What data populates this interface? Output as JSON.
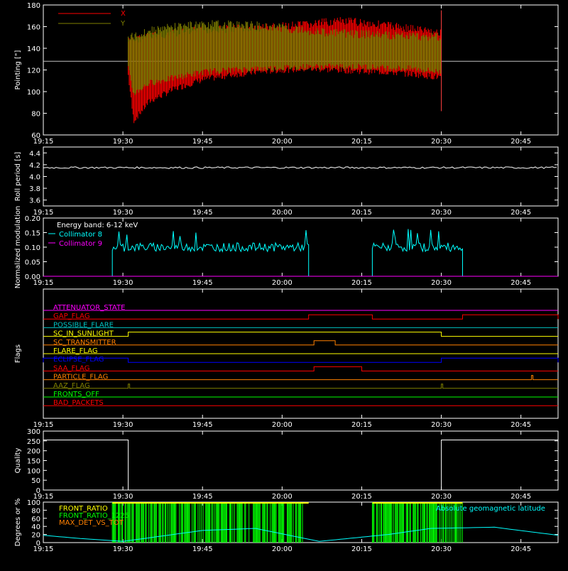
{
  "time_ticks": [
    "19:15",
    "19:30",
    "19:45",
    "20:00",
    "20:15",
    "20:30",
    "20:45"
  ],
  "chart_data": [
    {
      "type": "line",
      "title": "",
      "xlabel": "",
      "ylabel": "Pointing [\"]",
      "xlim": [
        "19:15",
        "20:52"
      ],
      "ylim": [
        60,
        180
      ],
      "yticks": [
        "60",
        "80",
        "100",
        "120",
        "140",
        "160",
        "180"
      ],
      "grid": false,
      "legend": "top-left",
      "reference_line": 128,
      "series": [
        {
          "name": "X",
          "color": "#ff0000",
          "x": [
            "19:31",
            "19:32",
            "19:35",
            "19:40",
            "19:45",
            "19:50",
            "19:55",
            "20:00",
            "20:05",
            "20:10",
            "20:15",
            "20:20",
            "20:25",
            "20:30"
          ],
          "upper": [
            150,
            152,
            155,
            158,
            161,
            162,
            163,
            164,
            166,
            169,
            168,
            165,
            162,
            158
          ],
          "lower": [
            112,
            70,
            88,
            100,
            108,
            112,
            115,
            117,
            118,
            117,
            116,
            115,
            113,
            110
          ]
        },
        {
          "name": "Y",
          "color": "#808000",
          "x": [
            "19:31",
            "19:32",
            "19:35",
            "19:40",
            "19:45",
            "19:50",
            "19:55",
            "20:00",
            "20:05",
            "20:10",
            "20:15",
            "20:20",
            "20:25",
            "20:30"
          ],
          "upper": [
            153,
            155,
            160,
            164,
            166,
            166,
            165,
            163,
            160,
            158,
            157,
            156,
            155,
            155
          ],
          "lower": [
            118,
            95,
            105,
            110,
            115,
            117,
            118,
            119,
            120,
            120,
            120,
            119,
            118,
            115
          ]
        }
      ]
    },
    {
      "type": "line",
      "title": "",
      "ylabel": "Roll period [s]",
      "xlim": [
        "19:15",
        "20:52"
      ],
      "ylim": [
        3.5,
        4.5
      ],
      "yticks": [
        "3.6",
        "3.8",
        "4.0",
        "4.2",
        "4.4"
      ],
      "series": [
        {
          "name": "",
          "color": "#ffffff",
          "value": 4.15
        }
      ]
    },
    {
      "type": "line",
      "title": "",
      "ylabel": "Normalized modulation",
      "xlim": [
        "19:15",
        "20:52"
      ],
      "ylim": [
        0,
        0.2
      ],
      "yticks": [
        "0.00",
        "0.05",
        "0.10",
        "0.15",
        "0.20"
      ],
      "legend": "top-left",
      "legend_header": "Energy band: 6-12 keV",
      "series": [
        {
          "name": "Collimator 8",
          "color": "#00ffff",
          "active_intervals": [
            [
              "19:28",
              "20:05"
            ],
            [
              "20:17",
              "20:34"
            ]
          ],
          "level": 0.1
        },
        {
          "name": "Collimator 9",
          "color": "#ff00ff",
          "value": 0.0
        }
      ]
    },
    {
      "type": "line",
      "title": "",
      "ylabel": "Flags",
      "xlim": [
        "19:15",
        "20:52"
      ],
      "series": [
        {
          "name": "ATTENUATOR_STATE",
          "color": "#ff00ff",
          "on": []
        },
        {
          "name": "GAP_FLAG",
          "color": "#ff0000",
          "on": [
            [
              "20:05",
              "20:17"
            ],
            [
              "20:34",
              "20:52"
            ]
          ]
        },
        {
          "name": "POSSIBLE_FLARE",
          "color": "#00c0c0",
          "on": []
        },
        {
          "name": "SC_IN_SUNLIGHT",
          "color": "#ffff00",
          "on": [
            [
              "19:31",
              "20:30"
            ]
          ]
        },
        {
          "name": "SC_TRANSMITTER",
          "color": "#ff8000",
          "on": [
            [
              "20:06",
              "20:10"
            ]
          ]
        },
        {
          "name": "FLARE_FLAG",
          "color": "#ffff00",
          "on": []
        },
        {
          "name": "ECLIPSE_FLAG",
          "color": "#0000ff",
          "on": [
            [
              "19:15",
              "19:31"
            ],
            [
              "20:30",
              "20:52"
            ]
          ]
        },
        {
          "name": "SAA_FLAG",
          "color": "#ff0000",
          "on": [
            [
              "20:06",
              "20:15"
            ]
          ]
        },
        {
          "name": "PARTICLE_FLAG",
          "color": "#ff8000",
          "on": [
            [
              "20:47",
              "20:47"
            ]
          ]
        },
        {
          "name": "AAZ_FLAG",
          "color": "#808000",
          "on": [
            [
              "19:31",
              "19:31"
            ],
            [
              "20:30",
              "20:30"
            ]
          ]
        },
        {
          "name": "FRONTS_OFF",
          "color": "#00ff00",
          "on": []
        },
        {
          "name": "BAD_PACKETS",
          "color": "#ff0000",
          "on": []
        }
      ]
    },
    {
      "type": "line",
      "title": "",
      "ylabel": "Quality",
      "xlim": [
        "19:15",
        "20:52"
      ],
      "ylim": [
        0,
        300
      ],
      "yticks": [
        "0",
        "50",
        "100",
        "150",
        "200",
        "250",
        "300"
      ],
      "series": [
        {
          "name": "",
          "color": "#ffffff",
          "x": [
            "19:15",
            "19:31",
            "19:31",
            "20:30",
            "20:30",
            "20:52"
          ],
          "y": [
            255,
            255,
            0,
            0,
            255,
            255
          ]
        }
      ]
    },
    {
      "type": "line",
      "title": "",
      "ylabel": "Degrees or %",
      "xlim": [
        "19:15",
        "20:52"
      ],
      "ylim": [
        0,
        100
      ],
      "yticks": [
        "0",
        "20",
        "40",
        "60",
        "80",
        "100"
      ],
      "legend": "top-left",
      "series": [
        {
          "name": "FRONT_RATIO",
          "color": "#ffff00",
          "active_intervals": [
            [
              "19:28",
              "20:05"
            ],
            [
              "20:17",
              "20:34"
            ]
          ]
        },
        {
          "name": "FRONT_RATIO_1225",
          "color": "#00ff00",
          "active_intervals": [
            [
              "19:28",
              "20:05"
            ],
            [
              "20:17",
              "20:34"
            ]
          ]
        },
        {
          "name": "MAX_DET_VS_TOT",
          "color": "#ff8000",
          "active_intervals": []
        },
        {
          "name": "Absolute geomagnetic latitude",
          "color": "#00ffff",
          "x": [
            "19:15",
            "19:22",
            "19:30",
            "19:45",
            "19:55",
            "20:07",
            "20:20",
            "20:28",
            "20:40",
            "20:52"
          ],
          "y": [
            18,
            10,
            3,
            30,
            35,
            3,
            20,
            35,
            38,
            18
          ]
        }
      ]
    }
  ]
}
